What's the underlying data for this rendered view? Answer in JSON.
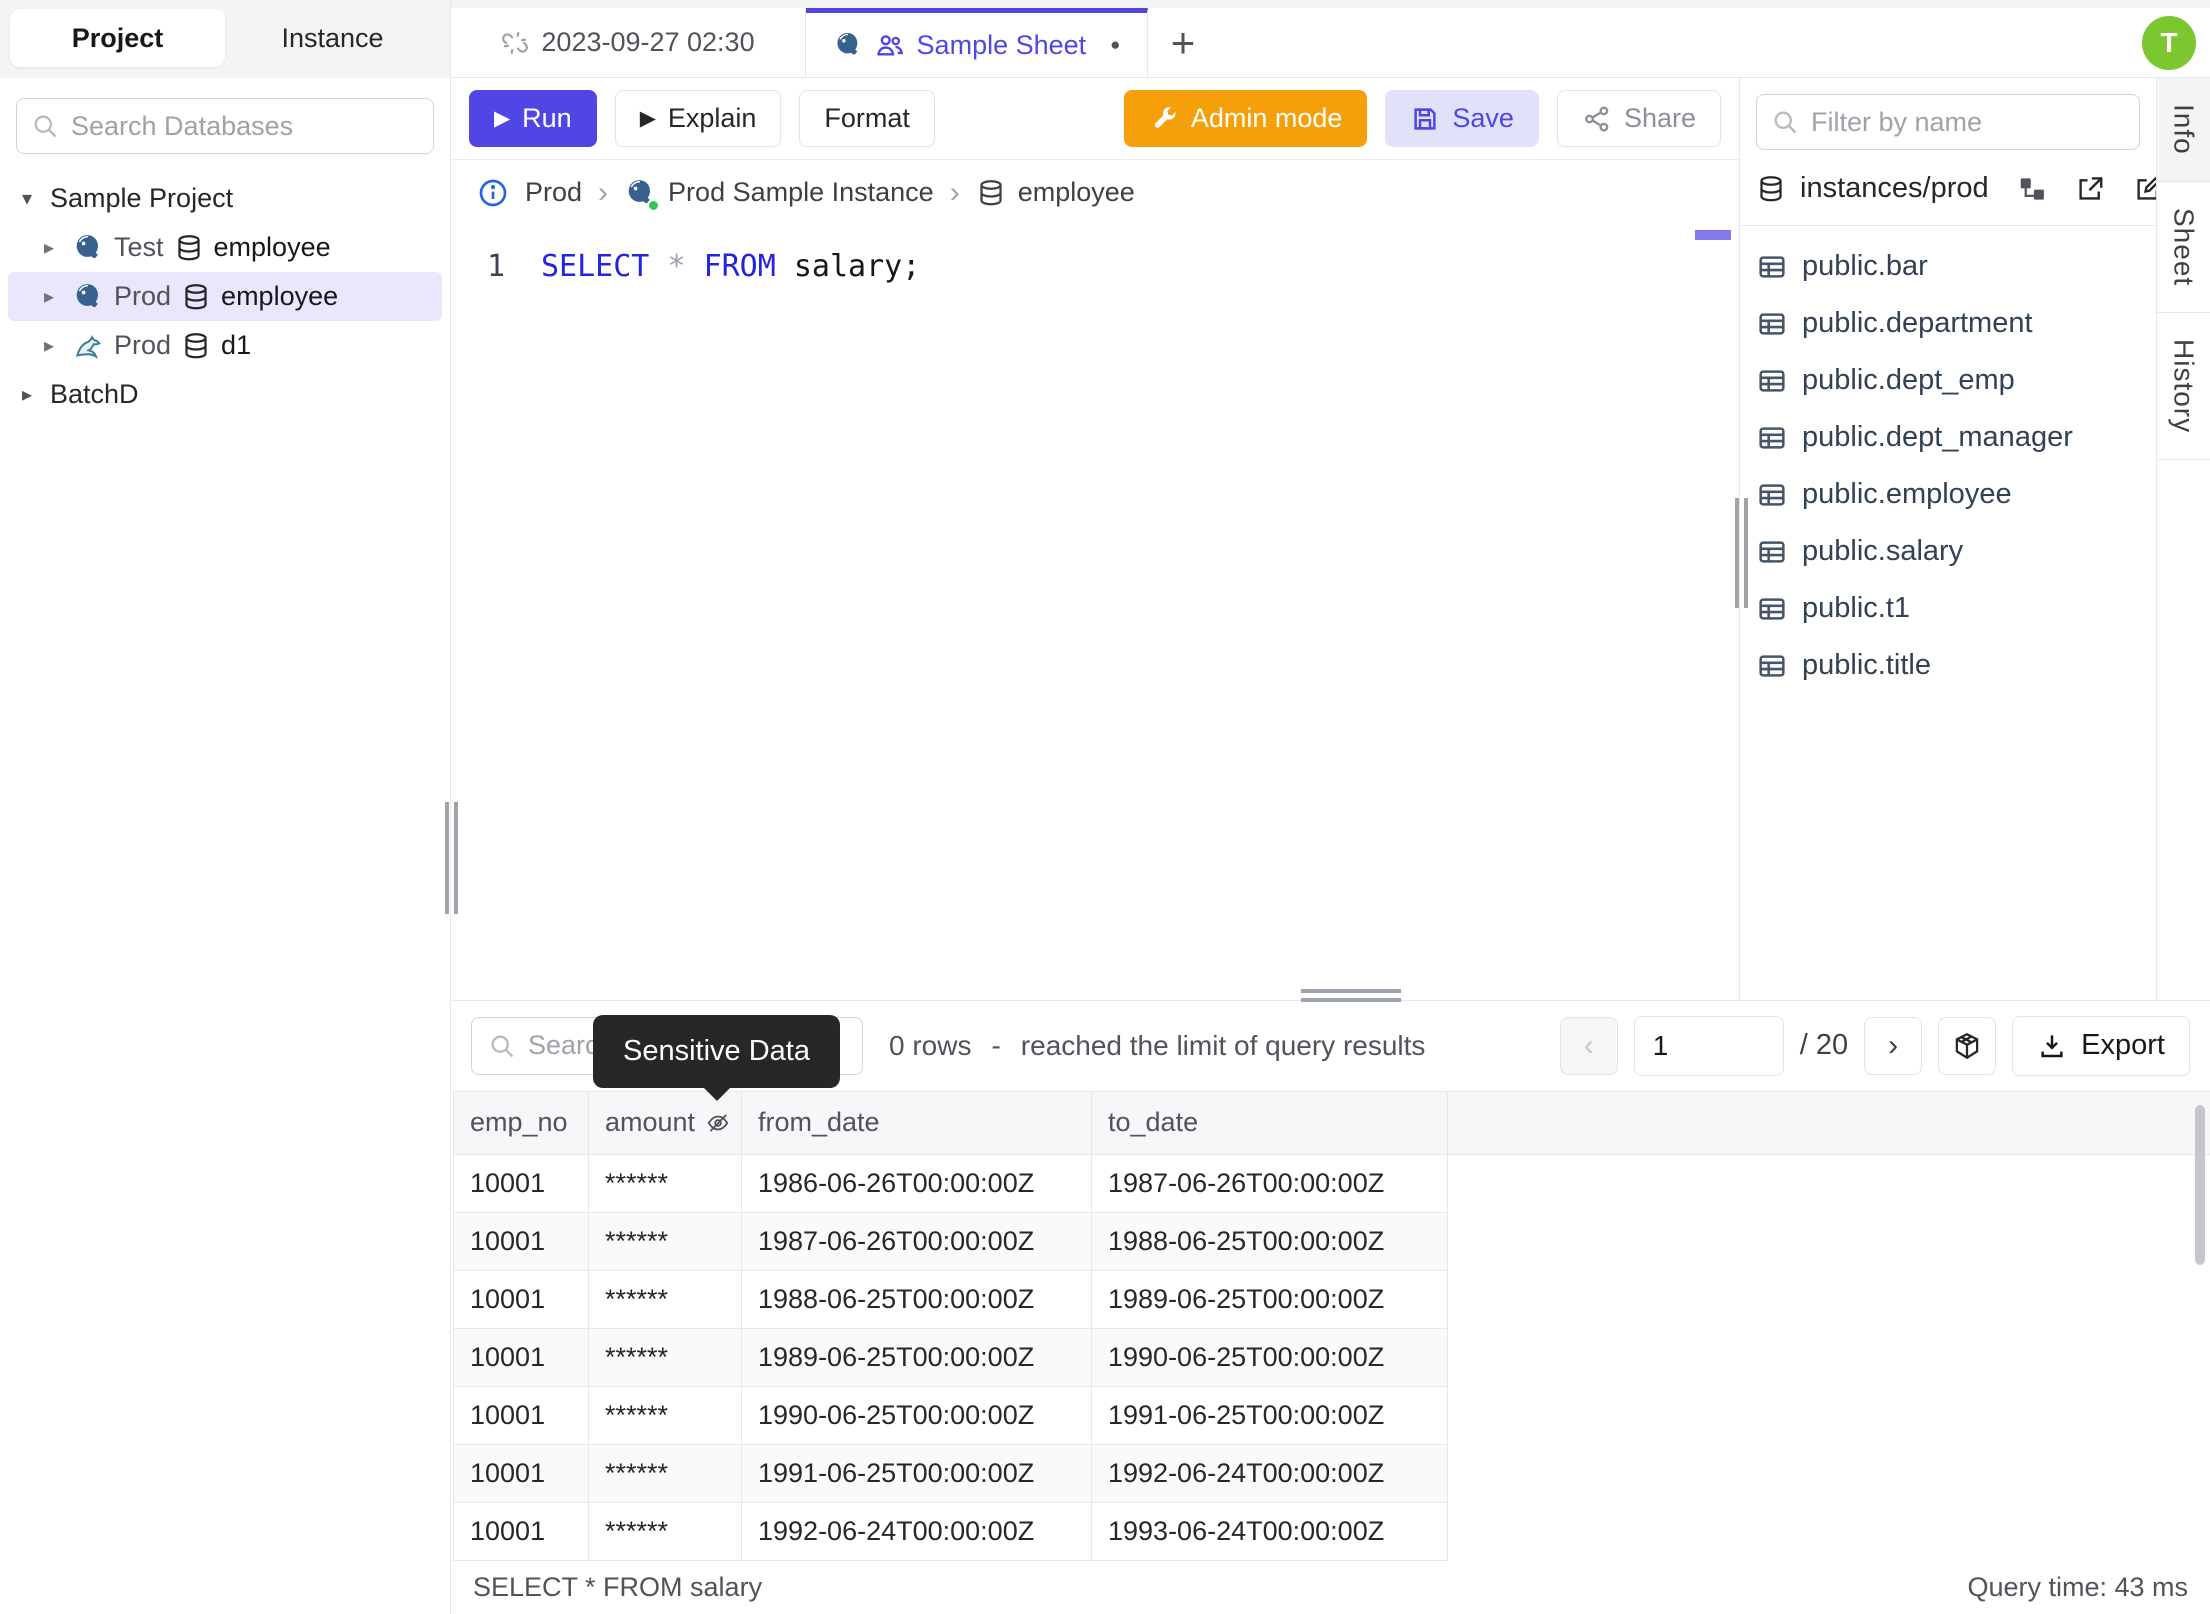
{
  "sidebar": {
    "tabs": [
      {
        "label": "Project"
      },
      {
        "label": "Instance"
      }
    ],
    "search_placeholder": "Search Databases",
    "tree": {
      "project_label": "Sample Project",
      "items": [
        {
          "env": "Test",
          "db": "employee",
          "engine": "postgres"
        },
        {
          "env": "Prod",
          "db": "employee",
          "engine": "postgres"
        },
        {
          "env": "Prod",
          "db": "d1",
          "engine": "mysql"
        }
      ],
      "batch_label": "BatchD"
    }
  },
  "tabstrip": {
    "history_tab": "2023-09-27 02:30",
    "active_tab": "Sample Sheet",
    "dirty_dot": "●",
    "new_tab": "+",
    "avatar_initial": "T"
  },
  "toolbar": {
    "run": "Run",
    "explain": "Explain",
    "format": "Format",
    "admin_mode": "Admin mode",
    "save": "Save",
    "share": "Share",
    "play_glyph": "▶"
  },
  "breadcrumb": {
    "env": "Prod",
    "instance": "Prod Sample Instance",
    "database": "employee",
    "sep": "›"
  },
  "editor": {
    "line_number": "1",
    "sql_kw1": "SELECT",
    "sql_star": "*",
    "sql_kw2": "FROM",
    "sql_rest": "salary;"
  },
  "schema_panel": {
    "filter_placeholder": "Filter by name",
    "header": "instances/prod",
    "tables": [
      "public.bar",
      "public.department",
      "public.dept_emp",
      "public.dept_manager",
      "public.employee",
      "public.salary",
      "public.t1",
      "public.title"
    ]
  },
  "side_tabs": [
    "Info",
    "Sheet",
    "History"
  ],
  "results": {
    "search_placeholder": "Search",
    "tooltip": "Sensitive Data",
    "rows_info": "0 rows",
    "separator": "-",
    "limit_info": "reached the limit of query results",
    "page": "1",
    "page_total": "/ 20",
    "prev_glyph": "‹",
    "next_glyph": "›",
    "export": "Export",
    "columns": [
      "emp_no",
      "amount",
      "from_date",
      "to_date"
    ],
    "rows": [
      {
        "emp_no": "10001",
        "amount": "******",
        "from_date": "1986-06-26T00:00:00Z",
        "to_date": "1987-06-26T00:00:00Z"
      },
      {
        "emp_no": "10001",
        "amount": "******",
        "from_date": "1987-06-26T00:00:00Z",
        "to_date": "1988-06-25T00:00:00Z"
      },
      {
        "emp_no": "10001",
        "amount": "******",
        "from_date": "1988-06-25T00:00:00Z",
        "to_date": "1989-06-25T00:00:00Z"
      },
      {
        "emp_no": "10001",
        "amount": "******",
        "from_date": "1989-06-25T00:00:00Z",
        "to_date": "1990-06-25T00:00:00Z"
      },
      {
        "emp_no": "10001",
        "amount": "******",
        "from_date": "1990-06-25T00:00:00Z",
        "to_date": "1991-06-25T00:00:00Z"
      },
      {
        "emp_no": "10001",
        "amount": "******",
        "from_date": "1991-06-25T00:00:00Z",
        "to_date": "1992-06-24T00:00:00Z"
      },
      {
        "emp_no": "10001",
        "amount": "******",
        "from_date": "1992-06-24T00:00:00Z",
        "to_date": "1993-06-24T00:00:00Z"
      }
    ],
    "status_query": "SELECT * FROM salary",
    "query_time": "Query time: 43 ms"
  },
  "colors": {
    "accent_indigo": "#4f46e5",
    "admin_orange": "#f5a00b",
    "avatar_green": "#7cc62f",
    "keyword_blue": "#2424dd",
    "selected_row_bg": "#e9e7fc",
    "tooltip_bg": "#27272a"
  }
}
